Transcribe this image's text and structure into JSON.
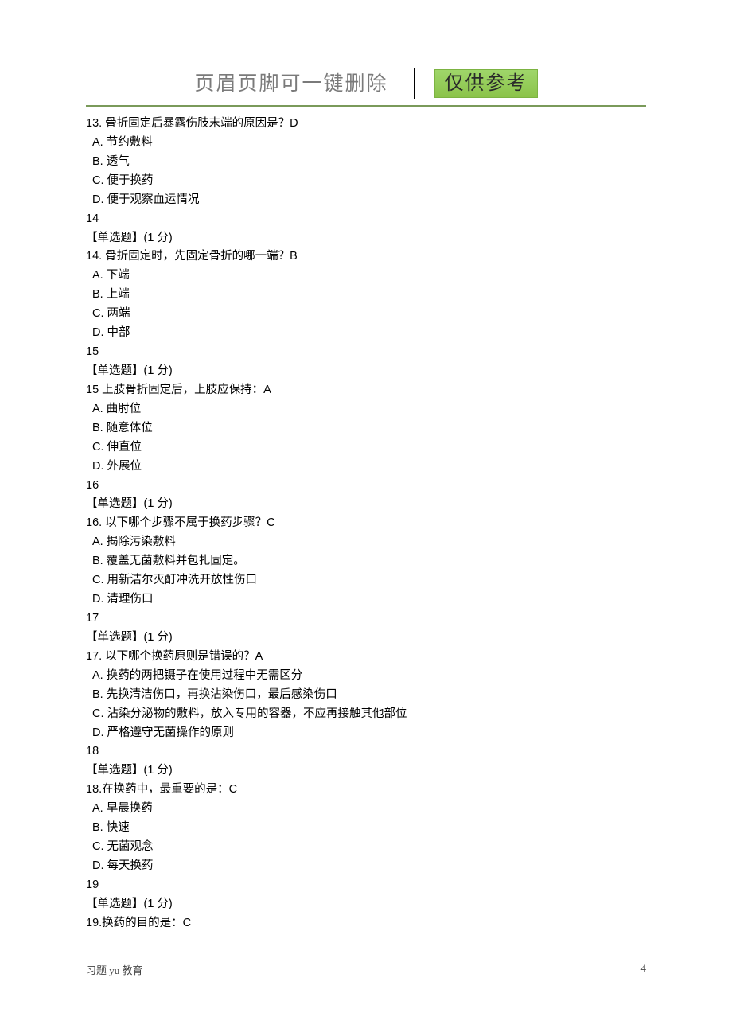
{
  "header": {
    "title": "页眉页脚可一键删除",
    "badge": "仅供参考"
  },
  "questions": [
    {
      "number": "13.",
      "text": "骨折固定后暴露伤肢末端的原因是？D",
      "options": [
        {
          "label": "A.",
          "text": "节约敷料"
        },
        {
          "label": "B.",
          "text": "透气"
        },
        {
          "label": "C.",
          "text": "便于换药"
        },
        {
          "label": "D.",
          "text": "便于观察血运情况"
        }
      ]
    },
    {
      "seq": "14",
      "meta": "【单选题】(1 分)",
      "number": "14.",
      "text": "骨折固定时，先固定骨折的哪一端？B",
      "options": [
        {
          "label": "A.",
          "text": "下端"
        },
        {
          "label": "B.",
          "text": "上端"
        },
        {
          "label": "C.",
          "text": "两端"
        },
        {
          "label": "D.",
          "text": "中部"
        }
      ]
    },
    {
      "seq": "15",
      "meta": "【单选题】(1 分)",
      "number": "15",
      "text": "上肢骨折固定后，上肢应保持：A",
      "options": [
        {
          "label": "A.",
          "text": "曲肘位"
        },
        {
          "label": "B.",
          "text": "随意体位"
        },
        {
          "label": "C.",
          "text": "伸直位"
        },
        {
          "label": "D.",
          "text": "外展位"
        }
      ]
    },
    {
      "seq": "16",
      "meta": "【单选题】(1 分)",
      "number": "16.",
      "text": "以下哪个步骤不属于换药步骤？C",
      "options": [
        {
          "label": "A.",
          "text": "揭除污染敷料"
        },
        {
          "label": "B.",
          "text": "覆盖无菌敷料并包扎固定。"
        },
        {
          "label": "C.",
          "text": "用新洁尔灭酊冲洗开放性伤口"
        },
        {
          "label": "D.",
          "text": "清理伤口"
        }
      ]
    },
    {
      "seq": "17",
      "meta": "【单选题】(1 分)",
      "number": "17.",
      "text": "以下哪个换药原则是错误的？A",
      "options": [
        {
          "label": "A.",
          "text": "换药的两把镊子在使用过程中无需区分"
        },
        {
          "label": "B.",
          "text": "先换清洁伤口，再换沾染伤口，最后感染伤口"
        },
        {
          "label": "C.",
          "text": "沾染分泌物的敷料，放入专用的容器，不应再接触其他部位"
        },
        {
          "label": "D.",
          "text": "严格遵守无菌操作的原则"
        }
      ]
    },
    {
      "seq": "18",
      "meta": "【单选题】(1 分)",
      "number": "18.",
      "text": "在换药中，最重要的是：C",
      "sep": "",
      "options": [
        {
          "label": "A.",
          "text": "早晨换药"
        },
        {
          "label": "B.",
          "text": "快速"
        },
        {
          "label": "C.",
          "text": "无菌观念"
        },
        {
          "label": "D.",
          "text": "每天换药"
        }
      ]
    },
    {
      "seq": "19",
      "meta": "【单选题】(1 分)",
      "number": "19.",
      "text": "换药的目的是：C",
      "sep": "",
      "options": []
    }
  ],
  "footer": {
    "left": "习题 yu 教育",
    "page": "4"
  }
}
